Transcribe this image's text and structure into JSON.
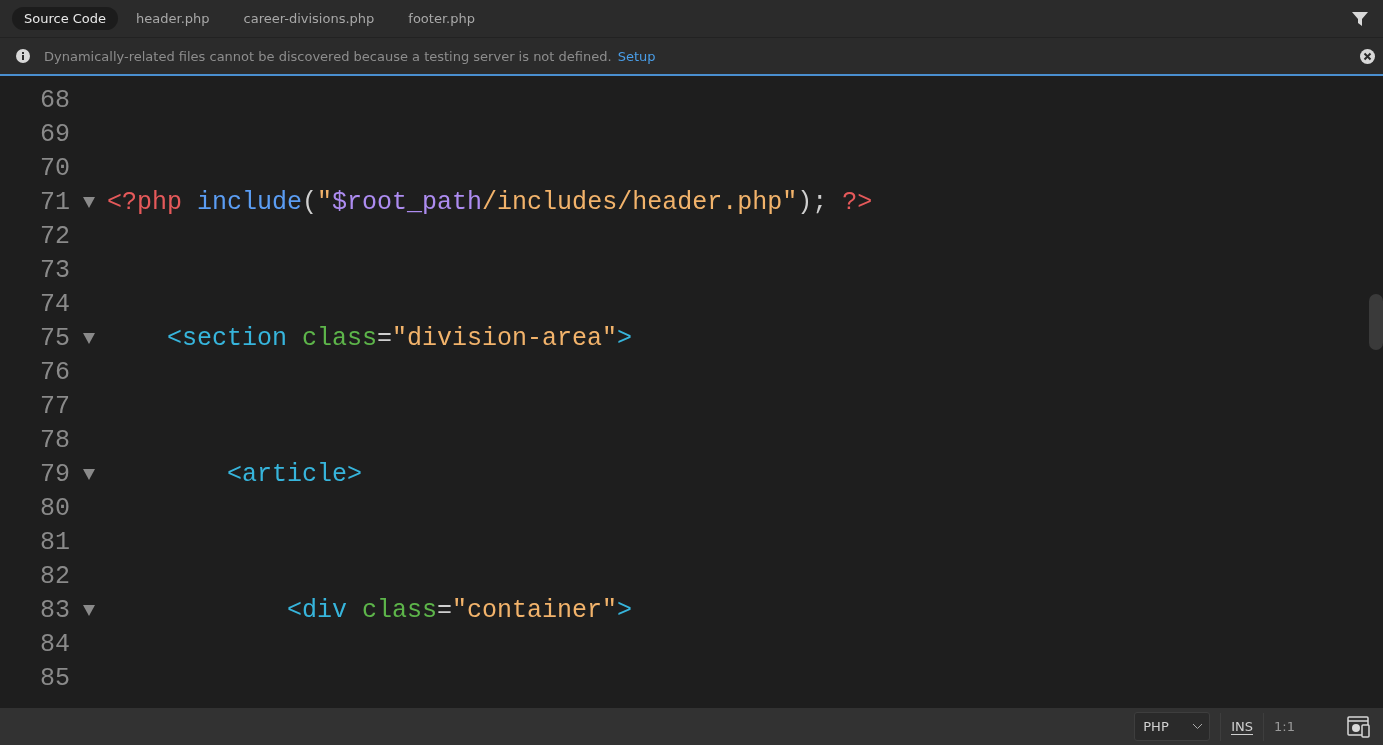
{
  "tabs": [
    {
      "label": "Source Code",
      "selected": true
    },
    {
      "label": "header.php",
      "selected": false
    },
    {
      "label": "career-divisions.php",
      "selected": false
    },
    {
      "label": "footer.php",
      "selected": false
    }
  ],
  "info_bar": {
    "message": "Dynamically-related files cannot be discovered because a testing server is not defined.",
    "link": "Setup"
  },
  "code_lines": [
    {
      "number": "68",
      "foldable": false
    },
    {
      "number": "69",
      "foldable": false
    },
    {
      "number": "70",
      "foldable": false
    },
    {
      "number": "71",
      "foldable": true,
      "tokens": [
        {
          "kind": "php",
          "text": "<?php"
        },
        {
          "kind": "keyword",
          "text": " include"
        },
        {
          "kind": "plain",
          "text": "("
        },
        {
          "kind": "string",
          "text": "\""
        },
        {
          "kind": "variable",
          "text": "$root_path"
        },
        {
          "kind": "string",
          "text": "/includes/header.php\""
        },
        {
          "kind": "plain",
          "text": "); "
        },
        {
          "kind": "php",
          "text": "?>"
        }
      ]
    },
    {
      "number": "72",
      "foldable": false
    },
    {
      "number": "73",
      "foldable": false
    },
    {
      "number": "74",
      "foldable": false
    },
    {
      "number": "75",
      "foldable": true,
      "tokens": [
        {
          "kind": "tag",
          "text": "    <section"
        },
        {
          "kind": "attr",
          "text": " class"
        },
        {
          "kind": "plain",
          "text": "="
        },
        {
          "kind": "string",
          "text": "\"division-area\""
        },
        {
          "kind": "tag",
          "text": ">"
        }
      ]
    },
    {
      "number": "76",
      "foldable": false
    },
    {
      "number": "77",
      "foldable": false
    },
    {
      "number": "78",
      "foldable": false
    },
    {
      "number": "79",
      "foldable": true,
      "tokens": [
        {
          "kind": "tag",
          "text": "        <article>"
        }
      ]
    },
    {
      "number": "80",
      "foldable": false
    },
    {
      "number": "81",
      "foldable": false
    },
    {
      "number": "82",
      "foldable": false
    },
    {
      "number": "83",
      "foldable": true,
      "tokens": [
        {
          "kind": "tag",
          "text": "            <div"
        },
        {
          "kind": "attr",
          "text": " class"
        },
        {
          "kind": "plain",
          "text": "="
        },
        {
          "kind": "string",
          "text": "\"container\""
        },
        {
          "kind": "tag",
          "text": ">"
        }
      ]
    },
    {
      "number": "84",
      "foldable": false
    },
    {
      "number": "85",
      "foldable": false
    }
  ],
  "status_bar": {
    "language": "PHP",
    "mode": "INS",
    "position": "1:1"
  }
}
